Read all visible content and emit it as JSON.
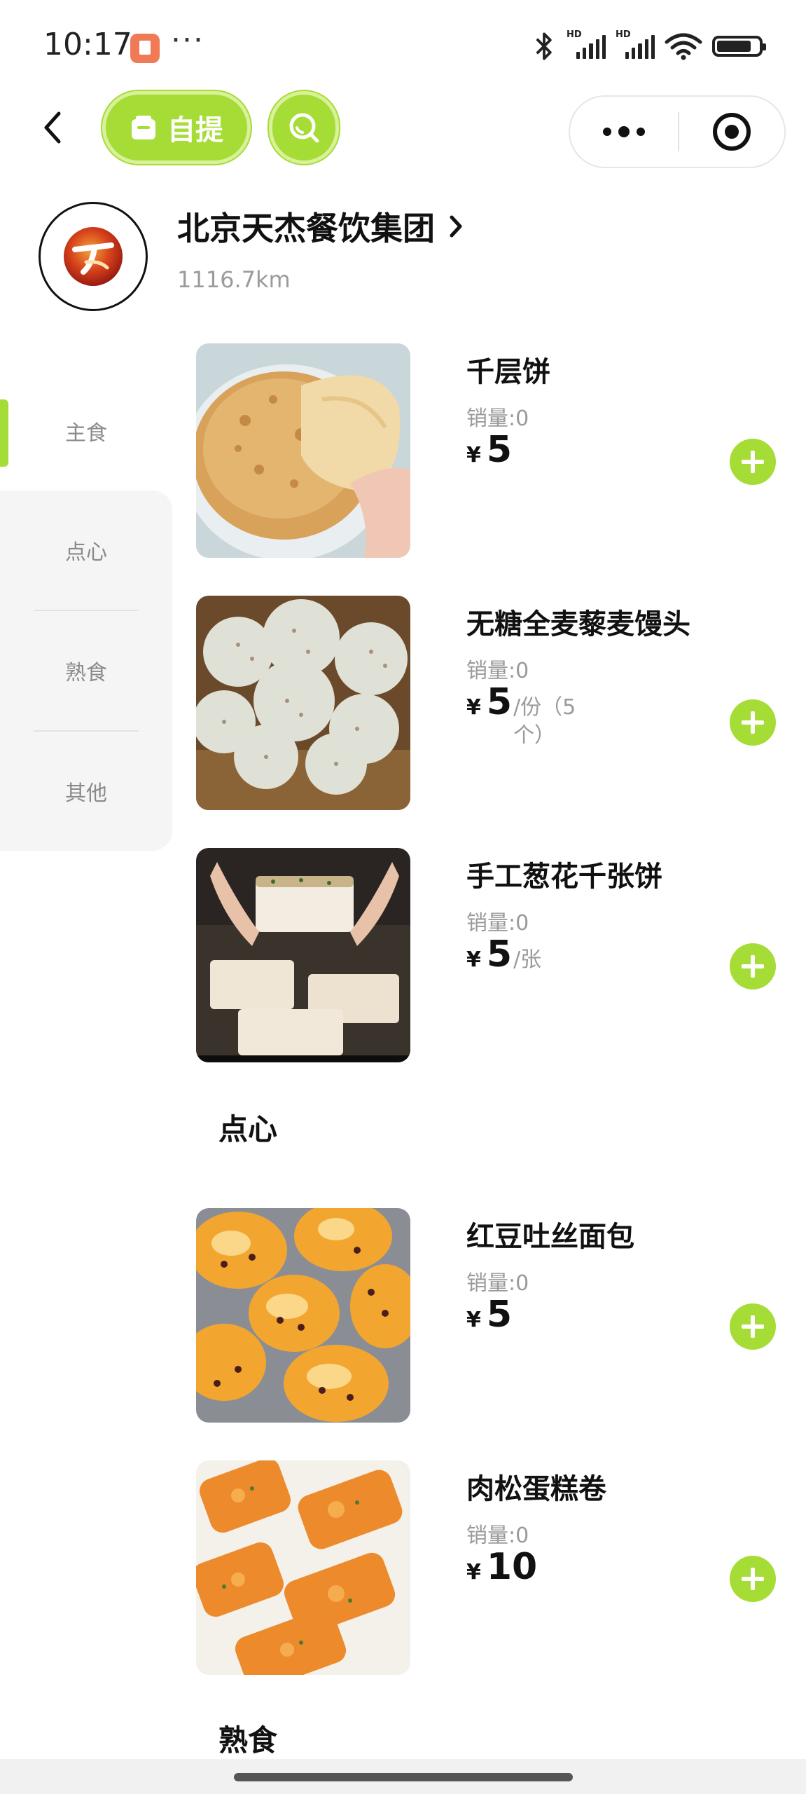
{
  "status_bar": {
    "time": "10:17",
    "more": "···",
    "hd1": "HD",
    "hd2": "HD",
    "icons": [
      "bluetooth-icon",
      "signal-icon",
      "signal-icon",
      "wifi-icon",
      "battery-icon"
    ]
  },
  "nav": {
    "back_icon": "chevron-left-icon",
    "pickup_label": "自提",
    "search_icon": "search-icon",
    "menu_icon": "more-icon",
    "close_icon": "target-icon"
  },
  "store": {
    "name": "北京天杰餐饮集团",
    "distance": "1116.7km"
  },
  "categories": [
    {
      "label": "主食",
      "active": true
    },
    {
      "label": "点心",
      "active": false
    },
    {
      "label": "熟食",
      "active": false
    },
    {
      "label": "其他",
      "active": false
    }
  ],
  "products": [
    {
      "name": "千层饼",
      "sales": "销量:0",
      "currency": "¥",
      "price": "5",
      "unit": ""
    },
    {
      "name": "无糖全麦藜麦馒头",
      "sales": "销量:0",
      "currency": "¥",
      "price": "5",
      "unit": "/份（5个）"
    },
    {
      "name": "手工葱花千张饼",
      "sales": "销量:0",
      "currency": "¥",
      "price": "5",
      "unit": "/张"
    },
    {
      "name": "红豆吐丝面包",
      "sales": "销量:0",
      "currency": "¥",
      "price": "5",
      "unit": ""
    },
    {
      "name": "肉松蛋糕卷",
      "sales": "销量:0",
      "currency": "¥",
      "price": "10",
      "unit": ""
    }
  ],
  "sections": {
    "dianxin": "点心",
    "shushi": "熟食"
  },
  "colors": {
    "accent": "#a6dc36",
    "accent_light": "#d8f19a",
    "sidebar_bg": "#f4f5f4"
  }
}
